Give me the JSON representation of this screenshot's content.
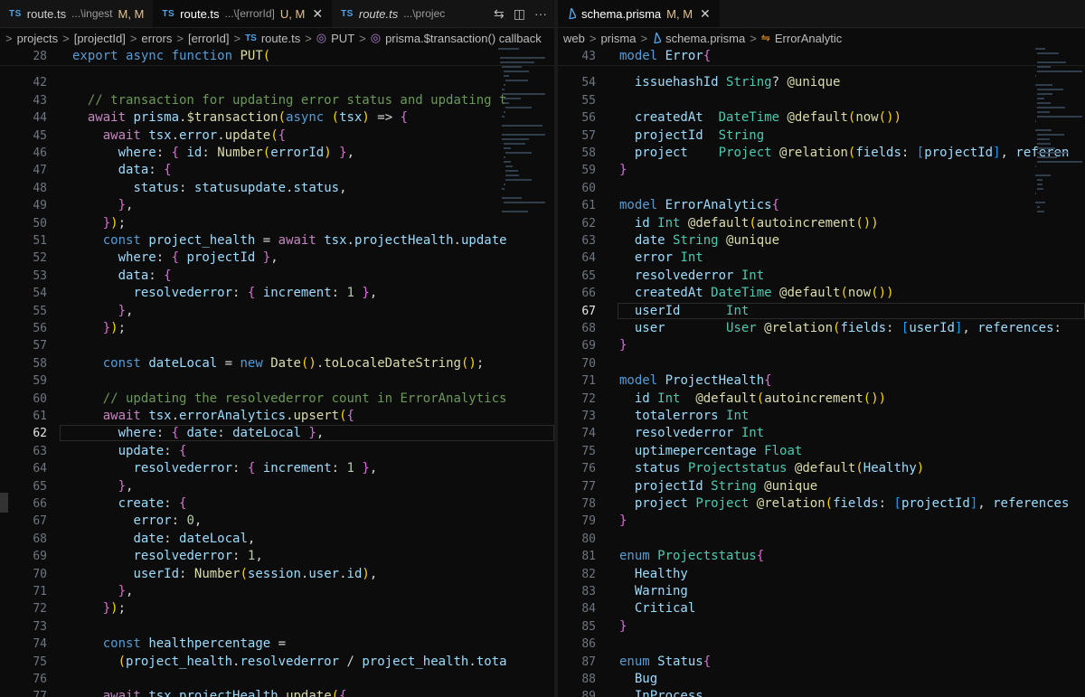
{
  "left_tabs": [
    {
      "icon": "TS",
      "name": "route.ts",
      "path": "...\\ingest",
      "status": "M, M"
    },
    {
      "icon": "TS",
      "name": "route.ts",
      "path": "...\\[errorId]",
      "status": "U, M",
      "close": "✕"
    },
    {
      "icon": "TS",
      "name": "route.ts",
      "path": "...\\projec"
    }
  ],
  "left_tab_actions": {
    "compare": "⇆",
    "split": "◫",
    "more": "···"
  },
  "left_breadcrumb": [
    "projects",
    "[projectId]",
    "errors",
    "[errorId]",
    "route.ts",
    "PUT",
    "prisma.$transaction() callback"
  ],
  "left_breadcrumb_icons": {
    "ts": "TS",
    "fn": "◎"
  },
  "right_tab": {
    "name": "schema.prisma",
    "status": "M, M",
    "close": "✕"
  },
  "right_breadcrumb": [
    "web",
    "prisma",
    "schema.prisma",
    "ErrorAnalytic"
  ],
  "right_breadcrumb_icons": {
    "model": "⇋"
  },
  "breadcrumb_sep": ">",
  "left_current_line": 62,
  "right_current_line": 67,
  "left_code": [
    {
      "n": "28",
      "t": "export async function PUT("
    },
    {
      "n": "42",
      "t": ""
    },
    {
      "n": "43",
      "t": "  // transaction for updating error status and updating t"
    },
    {
      "n": "44",
      "t": "  await prisma.$transaction(async (tsx) => {"
    },
    {
      "n": "45",
      "t": "    await tsx.error.update({"
    },
    {
      "n": "46",
      "t": "      where: { id: Number(errorId) },"
    },
    {
      "n": "47",
      "t": "      data: {"
    },
    {
      "n": "48",
      "t": "        status: statusupdate.status,"
    },
    {
      "n": "49",
      "t": "      },"
    },
    {
      "n": "50",
      "t": "    });"
    },
    {
      "n": "51",
      "t": "    const project_health = await tsx.projectHealth.update"
    },
    {
      "n": "52",
      "t": "      where: { projectId },"
    },
    {
      "n": "53",
      "t": "      data: {"
    },
    {
      "n": "54",
      "t": "        resolvederror: { increment: 1 },"
    },
    {
      "n": "55",
      "t": "      },"
    },
    {
      "n": "56",
      "t": "    });"
    },
    {
      "n": "57",
      "t": ""
    },
    {
      "n": "58",
      "t": "    const dateLocal = new Date().toLocaleDateString();"
    },
    {
      "n": "59",
      "t": ""
    },
    {
      "n": "60",
      "t": "    // updating the resolvederror count in ErrorAnalytics"
    },
    {
      "n": "61",
      "t": "    await tsx.errorAnalytics.upsert({"
    },
    {
      "n": "62",
      "t": "      where: { date: dateLocal },"
    },
    {
      "n": "63",
      "t": "      update: {"
    },
    {
      "n": "64",
      "t": "        resolvederror: { increment: 1 },"
    },
    {
      "n": "65",
      "t": "      },"
    },
    {
      "n": "66",
      "t": "      create: {"
    },
    {
      "n": "67",
      "t": "        error: 0,"
    },
    {
      "n": "68",
      "t": "        date: dateLocal,"
    },
    {
      "n": "69",
      "t": "        resolvederror: 1,"
    },
    {
      "n": "70",
      "t": "        userId: Number(session.user.id),"
    },
    {
      "n": "71",
      "t": "      },"
    },
    {
      "n": "72",
      "t": "    });"
    },
    {
      "n": "73",
      "t": ""
    },
    {
      "n": "74",
      "t": "    const healthpercentage ="
    },
    {
      "n": "75",
      "t": "      (project_health.resolvederror / project_health.tota"
    },
    {
      "n": "76",
      "t": ""
    },
    {
      "n": "77",
      "t": "    await tsx.projectHealth.update({"
    }
  ],
  "right_code": [
    {
      "n": "43",
      "t": "model Error{"
    },
    {
      "n": "54",
      "t": "  issuehashId String? @unique"
    },
    {
      "n": "55",
      "t": ""
    },
    {
      "n": "56",
      "t": "  createdAt  DateTime @default(now())"
    },
    {
      "n": "57",
      "t": "  projectId  String"
    },
    {
      "n": "58",
      "t": "  project    Project @relation(fields: [projectId], referen"
    },
    {
      "n": "59",
      "t": "}"
    },
    {
      "n": "60",
      "t": ""
    },
    {
      "n": "61",
      "t": "model ErrorAnalytics{"
    },
    {
      "n": "62",
      "t": "  id Int @default(autoincrement())"
    },
    {
      "n": "63",
      "t": "  date String @unique"
    },
    {
      "n": "64",
      "t": "  error Int"
    },
    {
      "n": "65",
      "t": "  resolvederror Int"
    },
    {
      "n": "66",
      "t": "  createdAt DateTime @default(now())"
    },
    {
      "n": "67",
      "t": "  userId      Int"
    },
    {
      "n": "68",
      "t": "  user        User @relation(fields: [userId], references:"
    },
    {
      "n": "69",
      "t": "}"
    },
    {
      "n": "70",
      "t": ""
    },
    {
      "n": "71",
      "t": "model ProjectHealth{"
    },
    {
      "n": "72",
      "t": "  id Int  @default(autoincrement())"
    },
    {
      "n": "73",
      "t": "  totalerrors Int"
    },
    {
      "n": "74",
      "t": "  resolvederror Int"
    },
    {
      "n": "75",
      "t": "  uptimepercentage Float"
    },
    {
      "n": "76",
      "t": "  status Projectstatus @default(Healthy)"
    },
    {
      "n": "77",
      "t": "  projectId String @unique"
    },
    {
      "n": "78",
      "t": "  project Project @relation(fields: [projectId], references"
    },
    {
      "n": "79",
      "t": "}"
    },
    {
      "n": "80",
      "t": ""
    },
    {
      "n": "81",
      "t": "enum Projectstatus{"
    },
    {
      "n": "82",
      "t": "  Healthy"
    },
    {
      "n": "83",
      "t": "  Warning"
    },
    {
      "n": "84",
      "t": "  Critical"
    },
    {
      "n": "85",
      "t": "}"
    },
    {
      "n": "86",
      "t": ""
    },
    {
      "n": "87",
      "t": "enum Status{"
    },
    {
      "n": "88",
      "t": "  Bug"
    },
    {
      "n": "89",
      "t": "  InProcess"
    }
  ],
  "colors": {
    "keyword": "#569cd6",
    "control": "#c586c0",
    "function": "#dcdcaa",
    "variable": "#9cdcfe",
    "number": "#b5cea8",
    "comment": "#6a9955",
    "type": "#4ec9b0"
  }
}
